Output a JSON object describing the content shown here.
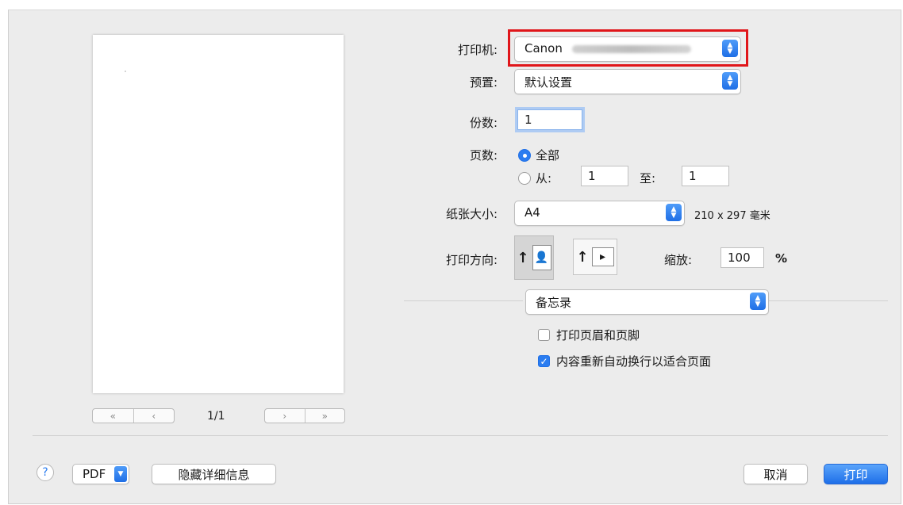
{
  "preview": {
    "page_indicator": "1/1",
    "first_page_icon": "«",
    "prev_page_icon": "‹",
    "next_page_icon": "›",
    "last_page_icon": "»"
  },
  "printer": {
    "label": "打印机:",
    "value": "Canon"
  },
  "presets": {
    "label": "预置:",
    "value": "默认设置"
  },
  "copies": {
    "label": "份数:",
    "value": "1"
  },
  "pages": {
    "label": "页数:",
    "all_label": "全部",
    "from_label": "从:",
    "from_value": "1",
    "to_label": "至:",
    "to_value": "1",
    "selected": "all"
  },
  "paper_size": {
    "label": "纸张大小:",
    "value": "A4",
    "dimensions": "210 x 297 毫米"
  },
  "orientation": {
    "label": "打印方向:",
    "selected": "portrait"
  },
  "scale": {
    "label": "缩放:",
    "value": "100",
    "unit": "%"
  },
  "app_section": {
    "value": "备忘录"
  },
  "options": {
    "header_footer": {
      "label": "打印页眉和页脚",
      "checked": false
    },
    "rewrap": {
      "label": "内容重新自动换行以适合页面",
      "checked": true
    }
  },
  "footer": {
    "help_icon": "?",
    "pdf_label": "PDF",
    "hide_details_label": "隐藏详细信息",
    "cancel_label": "取消",
    "print_label": "打印"
  },
  "colors": {
    "accent": "#2a7cf0",
    "highlight_box": "#e0161a",
    "dialog_bg": "#ececec"
  }
}
